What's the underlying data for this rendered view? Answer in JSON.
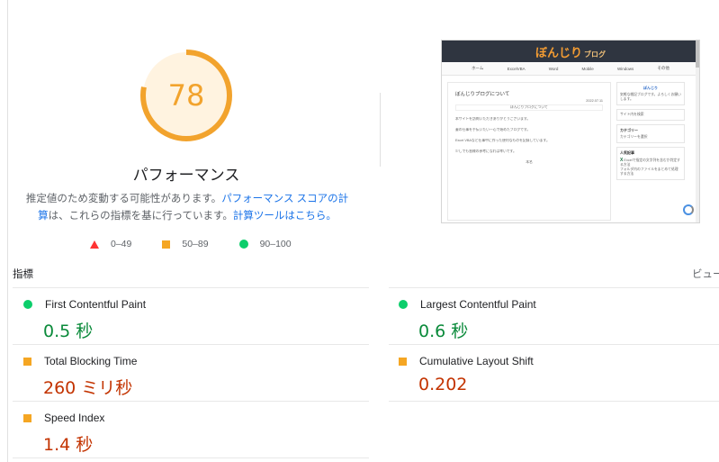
{
  "score": {
    "value": "78",
    "fraction": 0.78,
    "title": "パフォーマンス",
    "color": "#f2a32d",
    "bg_color": "#fff3e0"
  },
  "description": {
    "part1": "推定値のため変動する可能性があります。",
    "link1": "パフォーマンス スコアの計算",
    "part2": "は、これらの指標を基に行っています。",
    "link2": "計算ツールはこちら。"
  },
  "legend": [
    {
      "range": "0–49",
      "shape": "triangle",
      "color": "#ff3333"
    },
    {
      "range": "50–89",
      "shape": "square",
      "color": "#f5a623"
    },
    {
      "range": "90–100",
      "shape": "circle",
      "color": "#0cce6b"
    }
  ],
  "screenshot": {
    "brand": "ぼんじり",
    "brand_sub": "ブログ",
    "nav": [
      "ホーム",
      "ExcelVBA",
      "Word",
      "Mobile",
      "Windows",
      "その他"
    ],
    "post_title": "ぼんじりブログについて",
    "post_date": "2022.07.11",
    "post_tag": "ぼんじりブログについて",
    "post_lines": [
      "本サイトを訪問いただきありがとうございます。",
      "妻の仕事を手伝いたい一心で始めたブログです。",
      "Excel VBAなど仕事中に作った便利なものを記録しています。",
      "少しでも皆様の参考になれば幸いです。"
    ],
    "post_footer": "本名",
    "side": {
      "profile_title": "ぼんじり",
      "profile_text": "気軽な雑記ブログです。よろしくお願いします。",
      "search_placeholder": "サイト内を検索",
      "category_title": "カテゴリー",
      "category_select": "カテゴリーを選択",
      "popular_title": "人気記事",
      "popular_1": "Excelで指定の文字列を含むか判定する方法",
      "popular_2": "フォルダ内のファイルをまとめて処理する方法"
    }
  },
  "metrics": {
    "label": "指標",
    "toggle": "ビューを",
    "items": [
      {
        "name": "First Contentful Paint",
        "value": "0.5 秒",
        "status": "good"
      },
      {
        "name": "Largest Contentful Paint",
        "value": "0.6 秒",
        "status": "good"
      },
      {
        "name": "Total Blocking Time",
        "value": "260 ミリ秒",
        "status": "average"
      },
      {
        "name": "Cumulative Layout Shift",
        "value": "0.202",
        "status": "average"
      },
      {
        "name": "Speed Index",
        "value": "1.4 秒",
        "status": "average"
      }
    ]
  }
}
